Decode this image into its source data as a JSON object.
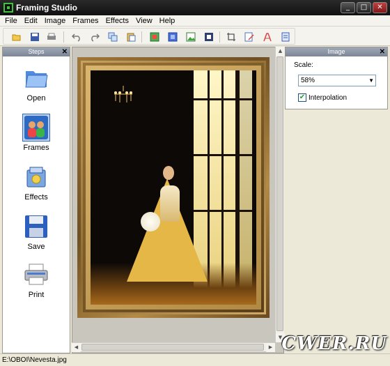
{
  "window": {
    "title": "Framing Studio",
    "minimize": "_",
    "maximize": "□",
    "close": "✕"
  },
  "menu": [
    "File",
    "Edit",
    "Image",
    "Frames",
    "Effects",
    "View",
    "Help"
  ],
  "toolbar": {
    "icons": [
      "open-icon",
      "save-icon",
      "print-icon",
      "undo-icon",
      "redo-icon",
      "copy-icon",
      "paste-icon",
      "frame-color-icon",
      "frame-blue-icon",
      "image-icon",
      "frame-square-icon",
      "crop-icon",
      "edit-image-icon",
      "text-icon",
      "export-icon"
    ]
  },
  "steps_panel": {
    "title": "Steps",
    "close": "✕",
    "items": [
      {
        "label": "Open",
        "icon": "folder-icon"
      },
      {
        "label": "Frames",
        "icon": "frames-people-icon",
        "selected": true
      },
      {
        "label": "Effects",
        "icon": "effects-icon"
      },
      {
        "label": "Save",
        "icon": "floppy-disk-icon"
      },
      {
        "label": "Print",
        "icon": "printer-icon"
      }
    ]
  },
  "image_panel": {
    "title": "Image",
    "close": "✕",
    "scale_label": "Scale:",
    "scale_value": "58%",
    "interpolation_label": "Interpolation",
    "interpolation_checked": true
  },
  "status": {
    "path": "E:\\OBOI\\Nevesta.jpg"
  },
  "watermark": "CWER.RU",
  "colors": {
    "titlebar": "#1a1a1a",
    "panel_header": "#8a93a3",
    "frame_gold": "#b08a44",
    "selection": "#c1d2ee"
  }
}
